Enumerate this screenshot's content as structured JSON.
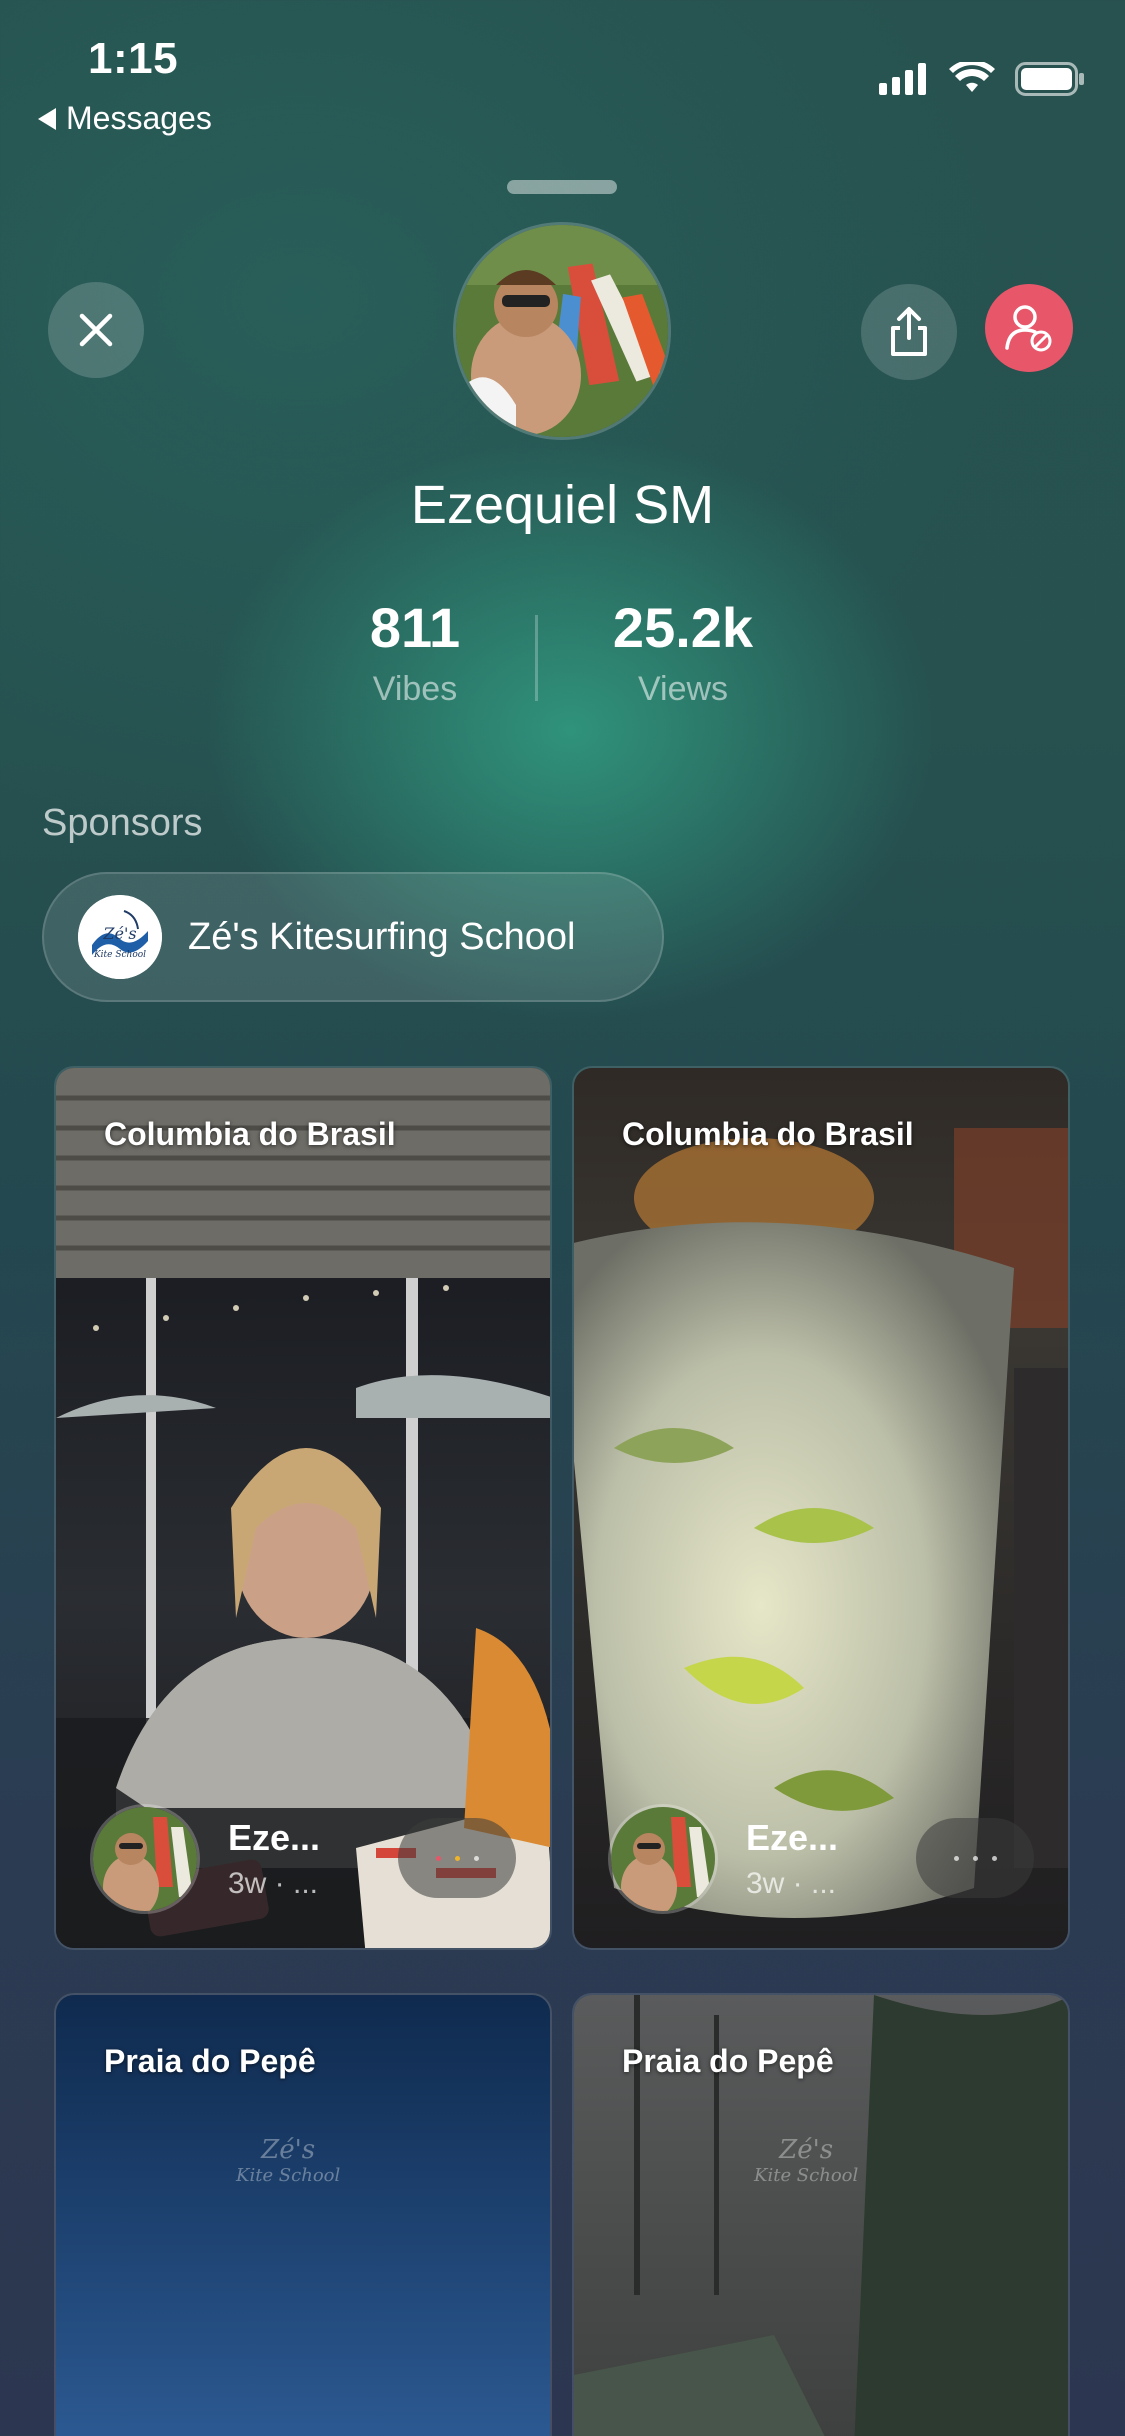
{
  "status_bar": {
    "time": "1:15",
    "back_label": "Messages"
  },
  "profile": {
    "name": "Ezequiel SM"
  },
  "stats": [
    {
      "value": "811",
      "label": "Vibes"
    },
    {
      "value": "25.2k",
      "label": "Views"
    }
  ],
  "sponsors": {
    "title": "Sponsors",
    "items": [
      {
        "name": "Zé's Kitesurfing School",
        "logo_text": "Zé's",
        "logo_sub": "Kite School"
      }
    ]
  },
  "posts": [
    {
      "location": "Columbia do Brasil",
      "author": "Eze...",
      "time": "3w · ..."
    },
    {
      "location": "Columbia do Brasil",
      "author": "Eze...",
      "time": "3w · ..."
    },
    {
      "location": "Praia do Pepê",
      "watermark": "Zé's",
      "watermark_sub": "Kite School"
    },
    {
      "location": "Praia do Pepê",
      "watermark": "Zé's",
      "watermark_sub": "Kite School"
    }
  ],
  "colors": {
    "block_button": "#e8566a",
    "accent_teal": "#30967d"
  }
}
